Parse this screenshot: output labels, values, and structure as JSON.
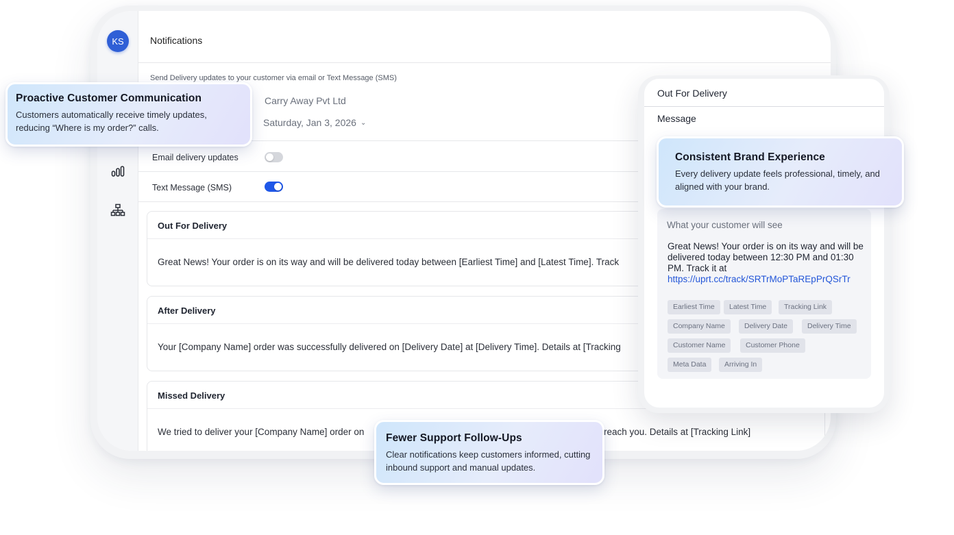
{
  "app": {
    "avatar_initials": "KS",
    "page_title": "Notifications",
    "subtitle": "Send Delivery updates to your customer via email or Text Message (SMS)",
    "company_name": "Carry Away Pvt Ltd",
    "date_value": "Saturday, Jan 3, 2026",
    "sidebar_icons": [
      "bar-chart-icon",
      "org-chart-icon"
    ],
    "toggles": [
      {
        "label": "Email delivery updates",
        "enabled": false
      },
      {
        "label": "Text Message (SMS)",
        "enabled": true
      }
    ],
    "toggle_on_color": "#1f57e8",
    "messages": [
      {
        "title": "Out For Delivery",
        "body": "Great News! Your order is on its way and will be delivered today between [Earliest Time] and [Latest Time]. Track"
      },
      {
        "title": "After Delivery",
        "body": "Your [Company Name] order was successfully delivered on [Delivery Date] at [Delivery Time]. Details at [Tracking"
      },
      {
        "title": "Missed Delivery",
        "body": "We tried to deliver your [Company Name] order on",
        "body_tail": "reach you. Details at [Tracking Link]"
      }
    ]
  },
  "phone": {
    "title": "Out For Delivery",
    "message_label": "Message",
    "preview_label": "What your customer will see",
    "preview_text": "Great News! Your order is on its way and will be delivered today between 12:30 PM and 01:30 PM. Track it at",
    "preview_link": "https://uprt.cc/track/SRTrMoPTaREpPrQSrTr",
    "link_color": "#2356d8",
    "chips": [
      "Earliest Time",
      "Latest Time",
      "Tracking Link",
      "Company Name",
      "Delivery Date",
      "Delivery Time",
      "Customer Name",
      "Customer Phone",
      "Meta Data",
      "Arriving In"
    ]
  },
  "callouts": {
    "proactive": {
      "title": "Proactive Customer Communication",
      "text": "Customers automatically receive timely updates, reducing “Where is my order?” calls."
    },
    "brand": {
      "title": "Consistent Brand Experience",
      "text": "Every delivery update feels professional, timely, and aligned with your brand."
    },
    "support": {
      "title": "Fewer Support Follow-Ups",
      "text": "Clear notifications keep customers informed, cutting inbound support and manual updates."
    }
  }
}
